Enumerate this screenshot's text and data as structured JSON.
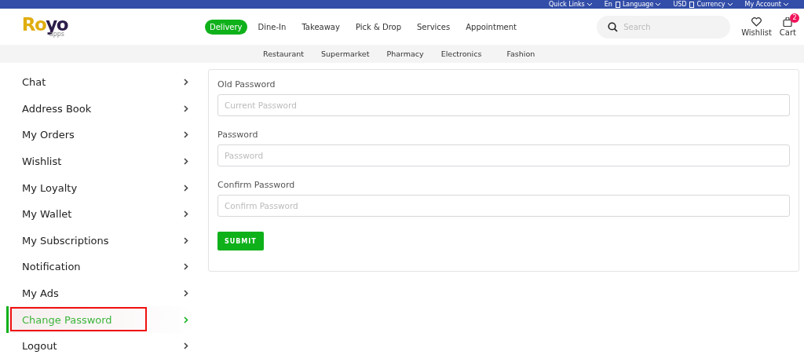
{
  "top_bar": {
    "links": [
      {
        "label": "Quick Links",
        "kind": "dropdown"
      },
      {
        "label": "En",
        "kind": "plain"
      },
      {
        "label": "Language",
        "kind": "dropdown-icon"
      },
      {
        "label": "USD",
        "kind": "plain"
      },
      {
        "label": "Currency",
        "kind": "dropdown-icon"
      },
      {
        "label": "My Account",
        "kind": "dropdown"
      }
    ]
  },
  "header": {
    "logo": {
      "main": "Royo",
      "sub": "apps"
    },
    "modes": [
      {
        "label": "Delivery",
        "selected": true
      },
      {
        "label": "Dine-In",
        "selected": false
      },
      {
        "label": "Takeaway",
        "selected": false
      },
      {
        "label": "Pick & Drop",
        "selected": false
      },
      {
        "label": "Services",
        "selected": false
      },
      {
        "label": "Appointment",
        "selected": false
      }
    ],
    "search": {
      "placeholder": "Search"
    },
    "wishlist": {
      "label": "Wishlist"
    },
    "cart": {
      "label": "Cart",
      "count": "2"
    }
  },
  "categories": [
    "Restaurant",
    "Supermarket",
    "Pharmacy",
    "Electronics",
    "Fashion"
  ],
  "sidebar": {
    "items": [
      {
        "label": "Chat",
        "selected": false
      },
      {
        "label": "Address Book",
        "selected": false
      },
      {
        "label": "My Orders",
        "selected": false
      },
      {
        "label": "Wishlist",
        "selected": false
      },
      {
        "label": "My Loyalty",
        "selected": false
      },
      {
        "label": "My Wallet",
        "selected": false
      },
      {
        "label": "My Subscriptions",
        "selected": false
      },
      {
        "label": "Notification",
        "selected": false
      },
      {
        "label": "My Ads",
        "selected": false
      },
      {
        "label": "Change Password",
        "selected": true
      },
      {
        "label": "Logout",
        "selected": false
      }
    ]
  },
  "form": {
    "fields": [
      {
        "label": "Old Password",
        "placeholder": "Current Password"
      },
      {
        "label": "Password",
        "placeholder": "Password"
      },
      {
        "label": "Confirm Password",
        "placeholder": "Confirm Password"
      }
    ],
    "submit": "SUBMIT"
  }
}
